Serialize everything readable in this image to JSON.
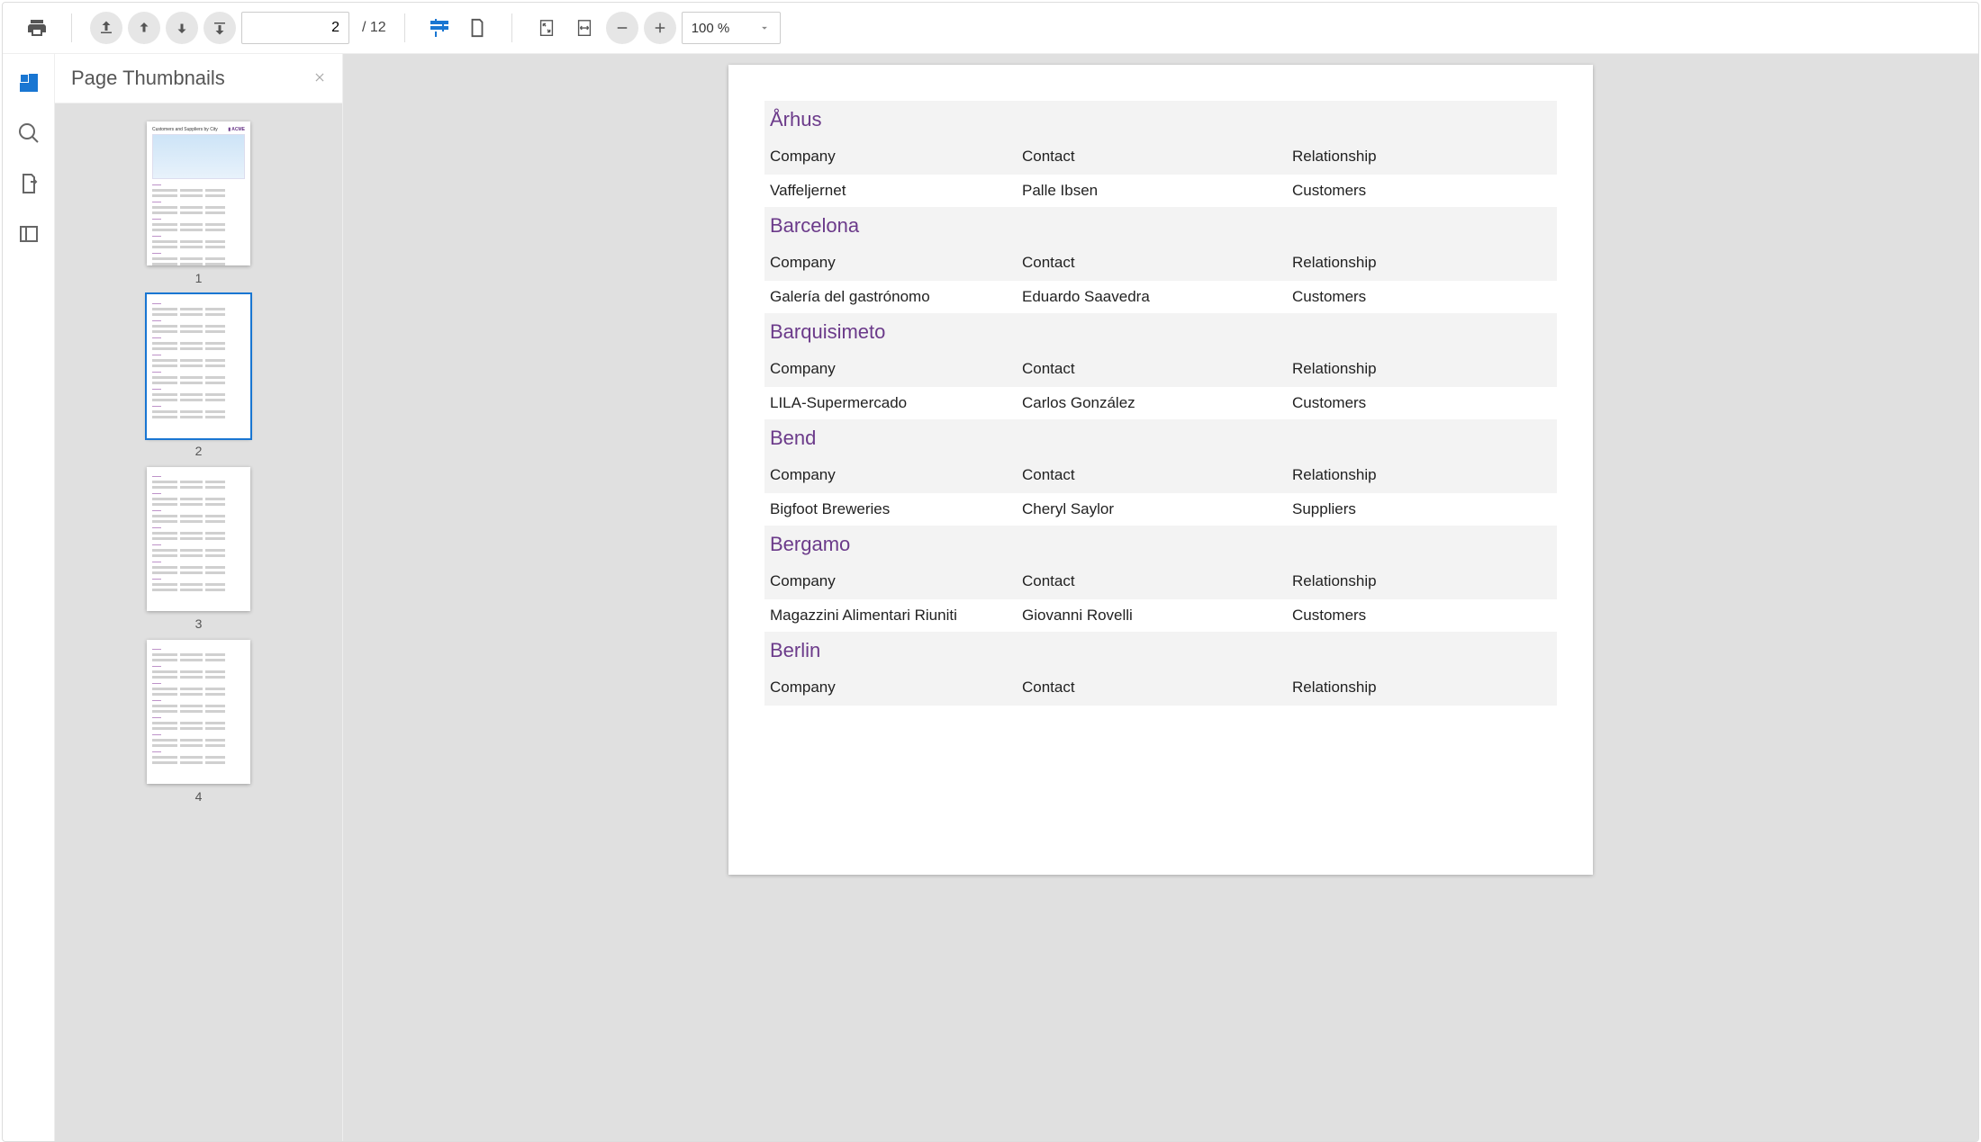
{
  "toolbar": {
    "current_page": "2",
    "total_pages": "12",
    "page_separator": "/",
    "zoom": "100 %"
  },
  "sidebar_panel": {
    "title": "Page Thumbnails",
    "thumbnails": [
      {
        "num": "1",
        "selected": false,
        "hasMap": true
      },
      {
        "num": "2",
        "selected": true,
        "hasMap": false
      },
      {
        "num": "3",
        "selected": false,
        "hasMap": false
      },
      {
        "num": "4",
        "selected": false,
        "hasMap": false
      }
    ]
  },
  "report": {
    "columns": [
      "Company",
      "Contact",
      "Relationship"
    ],
    "groups": [
      {
        "city": "Århus",
        "rows": [
          {
            "company": "Vaffeljernet",
            "contact": "Palle Ibsen",
            "rel": "Customers"
          }
        ]
      },
      {
        "city": "Barcelona",
        "rows": [
          {
            "company": "Galería del gastrónomo",
            "contact": "Eduardo Saavedra",
            "rel": "Customers"
          }
        ]
      },
      {
        "city": "Barquisimeto",
        "rows": [
          {
            "company": "LILA-Supermercado",
            "contact": "Carlos González",
            "rel": "Customers"
          }
        ]
      },
      {
        "city": "Bend",
        "rows": [
          {
            "company": "Bigfoot Breweries",
            "contact": "Cheryl Saylor",
            "rel": "Suppliers"
          }
        ]
      },
      {
        "city": "Bergamo",
        "rows": [
          {
            "company": "Magazzini Alimentari Riuniti",
            "contact": "Giovanni Rovelli",
            "rel": "Customers"
          }
        ]
      },
      {
        "city": "Berlin",
        "rows": [
          {
            "company": "",
            "contact": "",
            "rel": ""
          }
        ]
      }
    ]
  }
}
